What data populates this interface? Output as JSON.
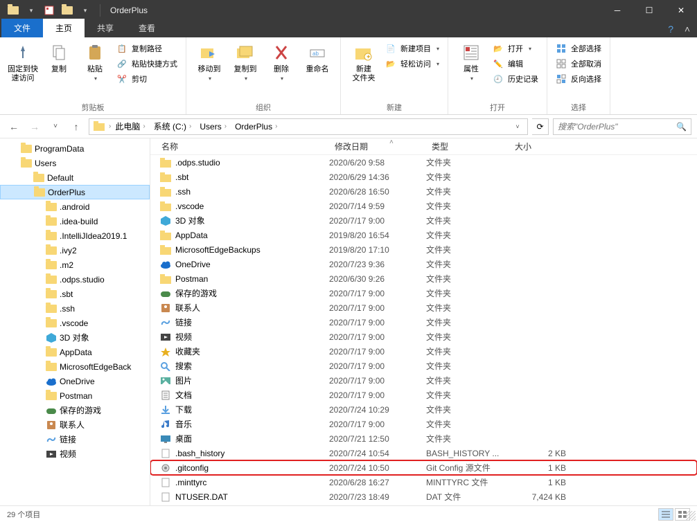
{
  "window": {
    "title": "OrderPlus"
  },
  "tabs": {
    "file": "文件",
    "home": "主页",
    "share": "共享",
    "view": "查看"
  },
  "ribbon": {
    "pin": {
      "line1": "固定到快",
      "line2": "速访问"
    },
    "copy": "复制",
    "paste": "粘贴",
    "cut": "剪切",
    "copypath": "复制路径",
    "pasteshortcut": "粘贴快捷方式",
    "group_clipboard": "剪贴板",
    "moveto": "移动到",
    "copyto": "复制到",
    "delete": "删除",
    "rename": "重命名",
    "group_organize": "组织",
    "newfolder": {
      "line1": "新建",
      "line2": "文件夹"
    },
    "newitem": "新建项目",
    "easyaccess": "轻松访问",
    "group_new": "新建",
    "properties": "属性",
    "open": "打开",
    "edit": "编辑",
    "history": "历史记录",
    "group_open": "打开",
    "selectall": "全部选择",
    "selectnone": "全部取消",
    "selectinvert": "反向选择",
    "group_select": "选择"
  },
  "breadcrumb": {
    "items": [
      "此电脑",
      "系统 (C:)",
      "Users",
      "OrderPlus"
    ],
    "dropdown": "▾"
  },
  "search": {
    "placeholder": "搜索\"OrderPlus\""
  },
  "tree": [
    {
      "name": "ProgramData",
      "indent": 1
    },
    {
      "name": "Users",
      "indent": 1
    },
    {
      "name": "Default",
      "indent": 2
    },
    {
      "name": "OrderPlus",
      "indent": 2,
      "selected": true
    },
    {
      "name": ".android",
      "indent": 3
    },
    {
      "name": ".idea-build",
      "indent": 3
    },
    {
      "name": ".IntelliJIdea2019.1",
      "indent": 3
    },
    {
      "name": ".ivy2",
      "indent": 3
    },
    {
      "name": ".m2",
      "indent": 3
    },
    {
      "name": ".odps.studio",
      "indent": 3
    },
    {
      "name": ".sbt",
      "indent": 3
    },
    {
      "name": ".ssh",
      "indent": 3
    },
    {
      "name": ".vscode",
      "indent": 3
    },
    {
      "name": "3D 对象",
      "indent": 3,
      "icon": "3d"
    },
    {
      "name": "AppData",
      "indent": 3
    },
    {
      "name": "MicrosoftEdgeBack",
      "indent": 3
    },
    {
      "name": "OneDrive",
      "indent": 3,
      "icon": "cloud"
    },
    {
      "name": "Postman",
      "indent": 3
    },
    {
      "name": "保存的游戏",
      "indent": 3,
      "icon": "game"
    },
    {
      "name": "联系人",
      "indent": 3,
      "icon": "contacts"
    },
    {
      "name": "链接",
      "indent": 3,
      "icon": "link"
    },
    {
      "name": "视频",
      "indent": 3,
      "icon": "video"
    }
  ],
  "columns": {
    "name": "名称",
    "date": "修改日期",
    "type": "类型",
    "size": "大小"
  },
  "files": [
    {
      "name": ".odps.studio",
      "date": "2020/6/20 9:58",
      "type": "文件夹",
      "size": "",
      "icon": "folder"
    },
    {
      "name": ".sbt",
      "date": "2020/6/29 14:36",
      "type": "文件夹",
      "size": "",
      "icon": "folder"
    },
    {
      "name": ".ssh",
      "date": "2020/6/28 16:50",
      "type": "文件夹",
      "size": "",
      "icon": "folder"
    },
    {
      "name": ".vscode",
      "date": "2020/7/14 9:59",
      "type": "文件夹",
      "size": "",
      "icon": "folder"
    },
    {
      "name": "3D 对象",
      "date": "2020/7/17 9:00",
      "type": "文件夹",
      "size": "",
      "icon": "3d"
    },
    {
      "name": "AppData",
      "date": "2019/8/20 16:54",
      "type": "文件夹",
      "size": "",
      "icon": "folder"
    },
    {
      "name": "MicrosoftEdgeBackups",
      "date": "2019/8/20 17:10",
      "type": "文件夹",
      "size": "",
      "icon": "folder"
    },
    {
      "name": "OneDrive",
      "date": "2020/7/23 9:36",
      "type": "文件夹",
      "size": "",
      "icon": "cloud"
    },
    {
      "name": "Postman",
      "date": "2020/6/30 9:26",
      "type": "文件夹",
      "size": "",
      "icon": "folder"
    },
    {
      "name": "保存的游戏",
      "date": "2020/7/17 9:00",
      "type": "文件夹",
      "size": "",
      "icon": "game"
    },
    {
      "name": "联系人",
      "date": "2020/7/17 9:00",
      "type": "文件夹",
      "size": "",
      "icon": "contacts"
    },
    {
      "name": "链接",
      "date": "2020/7/17 9:00",
      "type": "文件夹",
      "size": "",
      "icon": "link"
    },
    {
      "name": "视频",
      "date": "2020/7/17 9:00",
      "type": "文件夹",
      "size": "",
      "icon": "video"
    },
    {
      "name": "收藏夹",
      "date": "2020/7/17 9:00",
      "type": "文件夹",
      "size": "",
      "icon": "star"
    },
    {
      "name": "搜索",
      "date": "2020/7/17 9:00",
      "type": "文件夹",
      "size": "",
      "icon": "search"
    },
    {
      "name": "图片",
      "date": "2020/7/17 9:00",
      "type": "文件夹",
      "size": "",
      "icon": "pictures"
    },
    {
      "name": "文档",
      "date": "2020/7/17 9:00",
      "type": "文件夹",
      "size": "",
      "icon": "docs"
    },
    {
      "name": "下载",
      "date": "2020/7/24 10:29",
      "type": "文件夹",
      "size": "",
      "icon": "download"
    },
    {
      "name": "音乐",
      "date": "2020/7/17 9:00",
      "type": "文件夹",
      "size": "",
      "icon": "music"
    },
    {
      "name": "桌面",
      "date": "2020/7/21 12:50",
      "type": "文件夹",
      "size": "",
      "icon": "desktop"
    },
    {
      "name": ".bash_history",
      "date": "2020/7/24 10:54",
      "type": "BASH_HISTORY ...",
      "size": "2 KB",
      "icon": "file"
    },
    {
      "name": ".gitconfig",
      "date": "2020/7/24 10:50",
      "type": "Git Config 源文件",
      "size": "1 KB",
      "icon": "gear",
      "highlight": true
    },
    {
      "name": ".minttyrc",
      "date": "2020/6/28 16:27",
      "type": "MINTTYRC 文件",
      "size": "1 KB",
      "icon": "file"
    },
    {
      "name": "NTUSER.DAT",
      "date": "2020/7/23 18:49",
      "type": "DAT 文件",
      "size": "7,424 KB",
      "icon": "file"
    }
  ],
  "status": {
    "count": "29 个项目"
  }
}
